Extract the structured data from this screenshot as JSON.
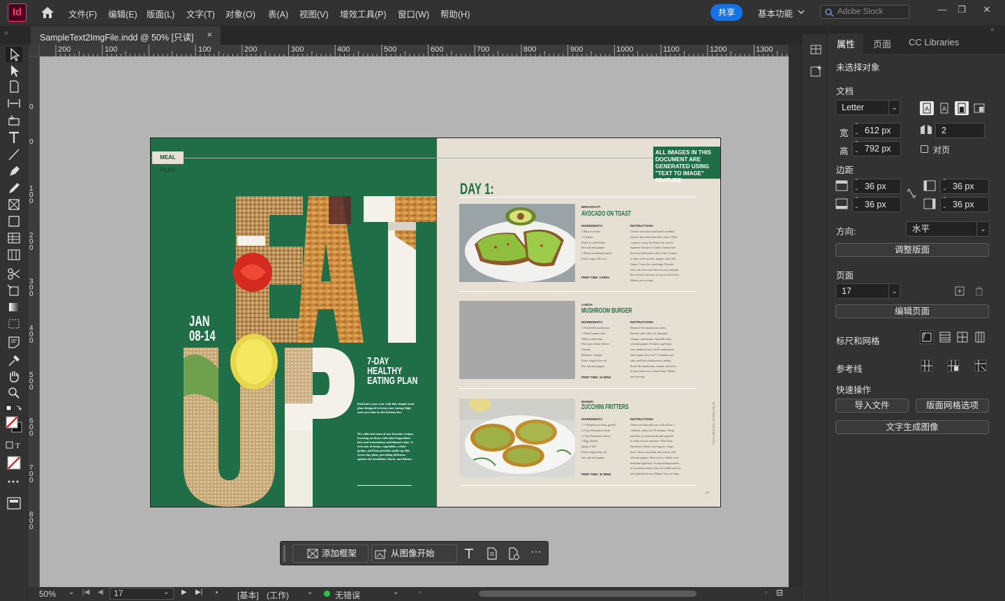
{
  "app": {
    "logo": "Id"
  },
  "menu": [
    "文件(F)",
    "编辑(E)",
    "版面(L)",
    "文字(T)",
    "对象(O)",
    "表(A)",
    "视图(V)",
    "增效工具(P)",
    "窗口(W)",
    "帮助(H)"
  ],
  "topbar": {
    "share": "共享",
    "workspace": "基本功能",
    "stock_placeholder": "Adobe Stock"
  },
  "tab": {
    "title": "SampleText2ImgFile.indd @ 50% [只读]",
    "close": "×"
  },
  "ruler": {
    "h": [
      "200",
      "100",
      "",
      "100",
      "200",
      "300",
      "400",
      "500",
      "600",
      "700",
      "800",
      "900",
      "1000",
      "1100",
      "1200",
      "1300"
    ],
    "v": [
      "0",
      "0",
      "1\n0\n0",
      "2\n0\n0",
      "3\n0\n0",
      "4\n0\n0",
      "5\n0\n0",
      "6\n0\n0",
      "7\n0\n0",
      "8\n0\n0"
    ]
  },
  "left_page": {
    "tag": "MEAL PLAN",
    "eat": "EAT",
    "up": "UP",
    "dates": "JAN\n08-14",
    "title": "7-DAY\nHEALTHY\nEATING PLAN",
    "body1": "Kickstart your year with this simple meal plan designed to keep your energy high and your time in the kitchen low.",
    "body2": "We collected some of our favorite recipes, focusing on those with short ingredient lists and tremendous nutritional value. A rich mix of fruits, vegetables, whole grains, and lean proteins make up this seven-day plan, providing delicious options for breakfast, lunch, and dinner."
  },
  "right_page": {
    "notice": "ALL IMAGES IN THIS DOCUMENT ARE GENERATED USING \"TEXT TO IMAGE\" FEATURE",
    "day": "DAY 1:",
    "side_text": "7-DAY HEALTHY EATING PLAN",
    "page_num": "22",
    "meals": [
      {
        "label": "BREAKFAST:",
        "name": "AVOCADO ON TOAST",
        "ing_head": "INGREDIENTS",
        "ingredients": "1 Ripe avocado\n½ Lemon\nPinch of chili flakes\nSea salt and pepper\n2 Slices sourdough bread\nExtra virgin olive oil",
        "ins_head": "INSTRUCTIONS",
        "instructions": "Cut the avocado in half and carefully\nremove the stone from the center. With\na spoon, scoop the flesh into a bowl.\nSqueeze the juice of half a lemon into\nthe bowl and mash with a fork. Season\nto taste with sea salt, pepper, and chili\nflakes. Toast the sourdough. Drizzle\nolive oil over each slice of toast and pile\nthe avocado mixture on top of each slice.\nMakes one serving.",
        "prep": "PREP TIME: 5 MINS"
      },
      {
        "label": "LUNCH:",
        "name": "MUSHROOM BURGER",
        "ing_head": "INGREDIENTS",
        "ingredients": "1 Portobello mushroom\n1 Thick tomato slice\nWhole wheat bun\nSlice provolone cheese\nTomato\nBalsamic vinegar\nExtra-virgin olive oil\nSea salt and pepper",
        "ins_head": "INSTRUCTIONS",
        "instructions": "Remove the mushroom stems.\nDrizzle with olive oil, balsamic\nvinegar, and tamari. Sprinkle with\nsalt and pepper. Preheat a grill pan\nover medium heat. Grill mushrooms\nand tomato slice for 5-7 minutes per\nside, until the mushroom is tender.\nStack the mushroom, tomato and slice\nof provolone on a toasted bun. Makes\none serving.",
        "prep": "PREP TIME: 10 MINS"
      },
      {
        "label": "DINNER:",
        "name": "ZUCCHINI FRITTERS",
        "ing_head": "INGREDIENTS",
        "ingredients": "1 ½ Pounds zucchini, grated\n¼ Cup all-purpose flour\n¼ Cup Parmesan cheese\n1 Egg, beaten\nSprig of dill\nExtra-virgin olive oil\nSea salt and pepper",
        "ins_head": "INSTRUCTIONS",
        "instructions": "Grate zucchini and toss with salt in a\ncolander, drain for 10 minutes. Wrap\nzucchini in cheesecloth and squeeze\nto drain excess moisture. Mix flour,\nParmesan cheese, and egg in a large\nbowl. Stir in zucchini and season with\nsalt and pepper. Heat oil in a skillet over\nmedium-high heat. Scoop tablespoonfuls\nof zucchini mixture into the skillet and fry\nuntil golden brown. Makes four servings.",
        "prep": "PREP TIME: 30 MINS"
      }
    ]
  },
  "floatbar": {
    "add_frame": "添加框架",
    "from_image": "从图像开始"
  },
  "status": {
    "zoom": "50%",
    "page": "17",
    "style": "[基本]",
    "mode": "(工作)",
    "preflight": "无错误"
  },
  "panel": {
    "tabs": [
      "属性",
      "页面",
      "CC Libraries"
    ],
    "no_selection": "未选择对象",
    "document": "文档",
    "size": "Letter",
    "width_label": "宽",
    "width": "612 px",
    "height_label": "高",
    "height": "792 px",
    "pages": "2",
    "facing": "对页",
    "margins": "边距",
    "margin_top": "36 px",
    "margin_bottom": "36 px",
    "margin_left": "36 px",
    "margin_right": "36 px",
    "orientation_label": "方向:",
    "orientation": "水平",
    "adjust_layout": "调整版面",
    "page_section": "页面",
    "page_value": "17",
    "edit_page": "编辑页面",
    "rulers_grids": "标尺和网格",
    "guides": "参考线",
    "quick_actions": "快速操作",
    "import_file": "导入文件",
    "layout_grid": "版面网格选项",
    "text_to_image": "文字生成图像"
  },
  "colors": {
    "accent": "#1473e6",
    "page_green": "#1f6e48",
    "page_cream": "#e6dfd4",
    "logo": "#ff3366"
  }
}
